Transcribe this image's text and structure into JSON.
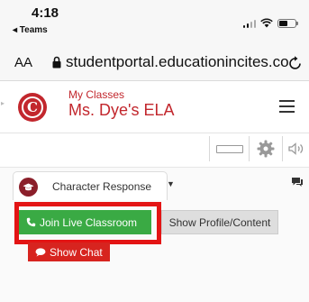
{
  "status_bar": {
    "time": "4:18",
    "back_app": "◂ Teams"
  },
  "browser": {
    "text_size_label": "AA",
    "url": "studentportal.educationincites.co"
  },
  "header": {
    "section_label": "My Classes",
    "class_name": "Ms. Dye's ELA",
    "logo_letter": "C"
  },
  "tabs": {
    "active_label": "Character Response"
  },
  "actions": {
    "join_label": "Join Live Classroom",
    "profile_label": "Show Profile/Content",
    "chat_label": "Show Chat"
  },
  "colors": {
    "brand": "#c2272d",
    "join": "#3aaa44",
    "highlight": "#e31414",
    "chat": "#d7241f"
  },
  "icons": [
    "signal-icon",
    "wifi-icon",
    "battery-icon",
    "lock-icon",
    "reload-icon",
    "hamburger-menu-icon",
    "horizontal-rule-icon",
    "gear-icon",
    "sound-icon",
    "chat-bubble-icon",
    "phone-icon",
    "graduation-cap-icon"
  ]
}
